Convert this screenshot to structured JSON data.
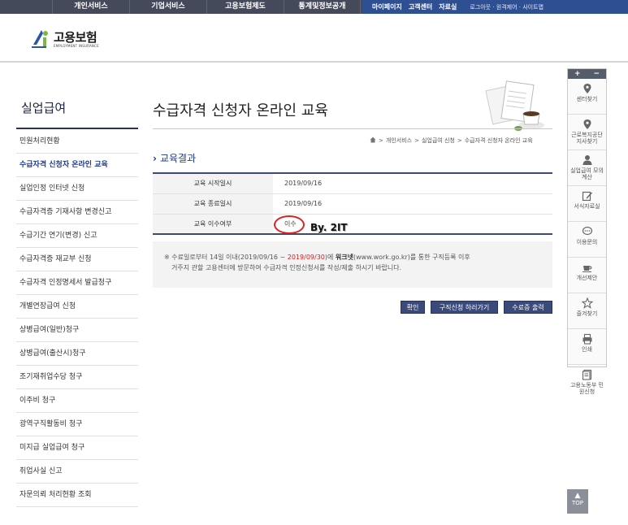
{
  "topnav": {
    "items": [
      "개인서비스",
      "기업서비스",
      "고용보험제도",
      "통계및정보공개"
    ],
    "right_items": [
      "마이페이지",
      "고객센터",
      "자료실"
    ],
    "util": "로그아웃 · 원격제어 · 사이트맵"
  },
  "logo": {
    "korean": "고용보험",
    "english": "EMPLOYMENT INSURANCE"
  },
  "sidebar": {
    "title": "실업급여",
    "items": [
      "민원처리현황",
      "수급자격 신청자 온라인 교육",
      "실업인정 인터넷 신청",
      "수급자격증 기재사항 변경신고",
      "수급기간 연기(변경) 신고",
      "수급자격증 재교부 신청",
      "수급자격 인정명세서 발급청구",
      "개별연장급여 신청",
      "상병급여(일반)청구",
      "상병급여(출산시)청구",
      "조기재취업수당 청구",
      "이주비 청구",
      "광역구직활동비 청구",
      "미지급 실업급여 청구",
      "취업사실 신고",
      "자문의뢰 처리현황 조회"
    ],
    "active_index": 1
  },
  "main": {
    "title": "수급자격 신청자 온라인 교육",
    "breadcrumb": [
      "개인서비스",
      "실업급여 신청",
      "수급자격 신청자 온라인 교육"
    ],
    "section_title": "교육결과",
    "rows": [
      {
        "label": "교육 시작일시",
        "value": "2019/09/16"
      },
      {
        "label": "교육 종료일시",
        "value": "2019/09/16"
      },
      {
        "label": "교육 이수여부",
        "value": "이수"
      }
    ],
    "watermark": "By. 2IT",
    "notice": {
      "line1_a": "※ 수료일로부터 14일 이내(2019/09/16 ~ ",
      "line1_red": "2019/09/30",
      "line1_b": ")에 ",
      "line1_bold": "워크넷",
      "line1_c": "(www.work.go.kr)를 통한 구직등록 이후",
      "line2": "거주지 관할 고용센터에 방문하여 수급자격 인정신청서를 작성/제출 하시기 바랍니다."
    },
    "buttons": {
      "confirm": "확인",
      "job_apply": "구직신청 하러가기",
      "cert_print": "수료증 출력"
    }
  },
  "quick_menu": {
    "plus": "+",
    "minus": "−",
    "items": [
      {
        "icon": "location-pin-icon",
        "label": "센터찾기"
      },
      {
        "icon": "location-pin-icon",
        "label": "근로복지공단 지사찾기"
      },
      {
        "icon": "person-icon",
        "label": "실업급여 모의계산"
      },
      {
        "icon": "edit-icon",
        "label": "서식자료실"
      },
      {
        "icon": "chat-icon",
        "label": "이용문의"
      },
      {
        "icon": "cup-icon",
        "label": "개선제안"
      },
      {
        "icon": "star-icon",
        "label": "즐겨찾기"
      },
      {
        "icon": "printer-icon",
        "label": "인쇄"
      },
      {
        "icon": "document-icon",
        "label": "고용노동부 민원신청"
      }
    ]
  },
  "top_button": "TOP",
  "colors": {
    "navy": "#2b3352",
    "button": "#3a4a7a",
    "accent_red": "#d02020"
  }
}
